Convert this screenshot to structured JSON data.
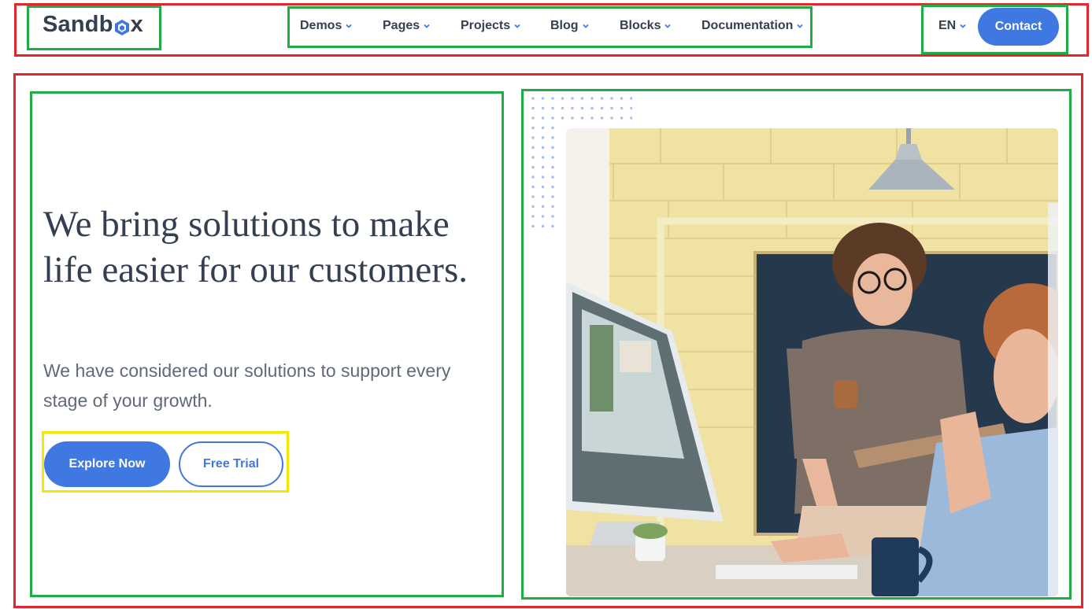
{
  "header": {
    "logo_text_before": "Sandb",
    "logo_text_after": "x",
    "nav": [
      {
        "label": "Demos"
      },
      {
        "label": "Pages"
      },
      {
        "label": "Projects"
      },
      {
        "label": "Blog"
      },
      {
        "label": "Blocks"
      },
      {
        "label": "Documentation"
      }
    ],
    "language": "EN",
    "contact_label": "Contact"
  },
  "hero": {
    "title": "We bring solutions to make life easier for our customers.",
    "subtitle": "We have considered our solutions to support every stage of your growth.",
    "primary_cta": "Explore Now",
    "secondary_cta": "Free Trial"
  },
  "colors": {
    "primary": "#3f78e0",
    "heading": "#343f52",
    "body_text": "#60697b",
    "annotation_red": "#e3262b",
    "annotation_green": "#1fae45",
    "annotation_yellow": "#f5e600"
  },
  "icons": {
    "chevron": "chevron-down-icon",
    "logo_cube": "cube-icon"
  }
}
